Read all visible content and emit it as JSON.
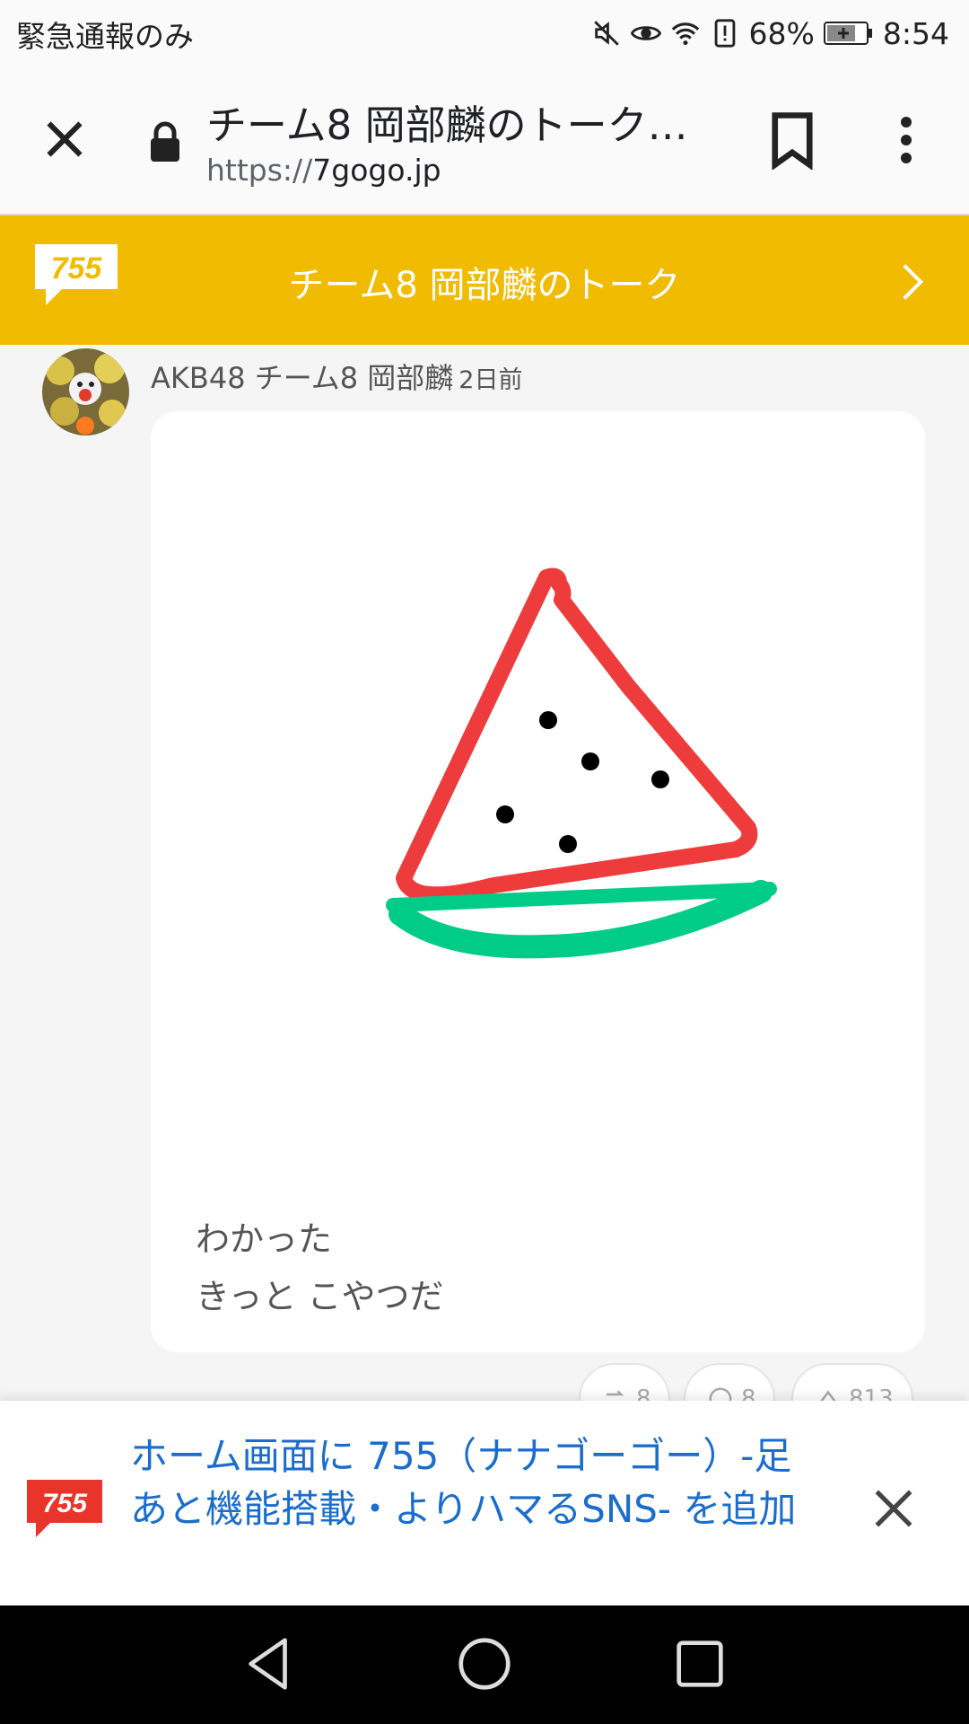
{
  "status_bar": {
    "left_text": "緊急通報のみ",
    "battery": "68%",
    "time": "8:54",
    "icons": [
      "mute-icon",
      "eye-icon",
      "wifi-icon",
      "alert-icon",
      "battery-icon"
    ]
  },
  "browser": {
    "title": "チーム8 岡部麟のトーク…",
    "url_scheme": "https://",
    "url_domain": "7gogo.jp"
  },
  "banner": {
    "logo_text": "755",
    "title": "チーム8 岡部麟のトーク",
    "background_color": "#f0bb00"
  },
  "post": {
    "author": "AKB48 チーム8 岡部麟",
    "time": "2日前",
    "text_line1": "わかった",
    "text_line2": "きっと こやつだ"
  },
  "reactions": {
    "repost_count": "8",
    "comment_count": "8",
    "clap_count": "813"
  },
  "install_prompt": {
    "logo_text": "755",
    "text": "ホーム画面に 755（ナナゴーゴー）-足あと機能搭載・よりハマるSNS- を追加",
    "link_color": "#1a6dcc"
  }
}
